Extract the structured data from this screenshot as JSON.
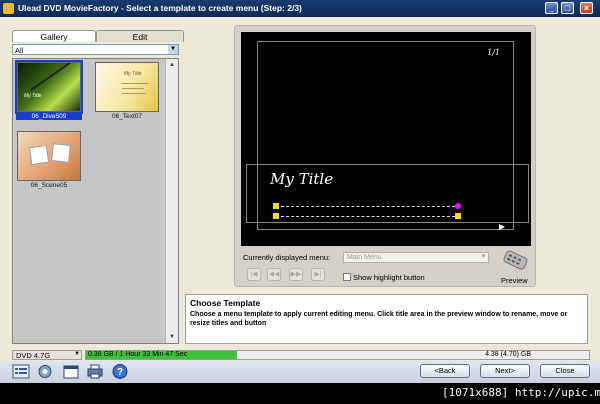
{
  "window": {
    "title": "Ulead DVD MovieFactory - Select a template to create menu (Step: 2/3)",
    "controls": [
      "_",
      "□",
      "×"
    ]
  },
  "left_panel": {
    "tabs": [
      {
        "label": "Gallery",
        "active": true
      },
      {
        "label": "Edit",
        "active": false
      }
    ],
    "filter": {
      "selected": "All"
    },
    "templates": [
      {
        "label": "06_Dive509",
        "selected": true
      },
      {
        "label": "06_Text07",
        "selected": false
      },
      {
        "label": "06_Scene05",
        "selected": false
      }
    ]
  },
  "preview": {
    "page_number": "1/1",
    "menu_title": "My Title",
    "currently_displayed_label": "Currently displayed menu:",
    "current_menu": "Main Menu",
    "show_highlight_label": "Show highlight button",
    "show_highlight_checked": false,
    "remote_label": "Preview"
  },
  "info": {
    "title": "Choose Template",
    "description": "Choose a menu template to apply current editing menu. Click title area in the preview window to rename, move or resize titles and button"
  },
  "status": {
    "disc_type": "DVD 4.7G",
    "used_text": "0.38 GB / 1 Hour 33 Min 47 Sec",
    "used_fraction": 0.3,
    "capacity_text": "4.38 (4.70) GB"
  },
  "toolbar": {
    "icons": [
      "menu-list-icon",
      "settings-icon",
      "calendar-icon",
      "printer-icon",
      "help-icon"
    ]
  },
  "buttons": {
    "back": "<Back",
    "next": "Next>",
    "close": "Close"
  },
  "watermark": "[1071x688] http://upic.me/",
  "colors": {
    "selection": "#1a3dc7",
    "progress": "#3ec03e",
    "highlight_square": "#ffdd00",
    "highlight_dot": "#ff00ff"
  }
}
